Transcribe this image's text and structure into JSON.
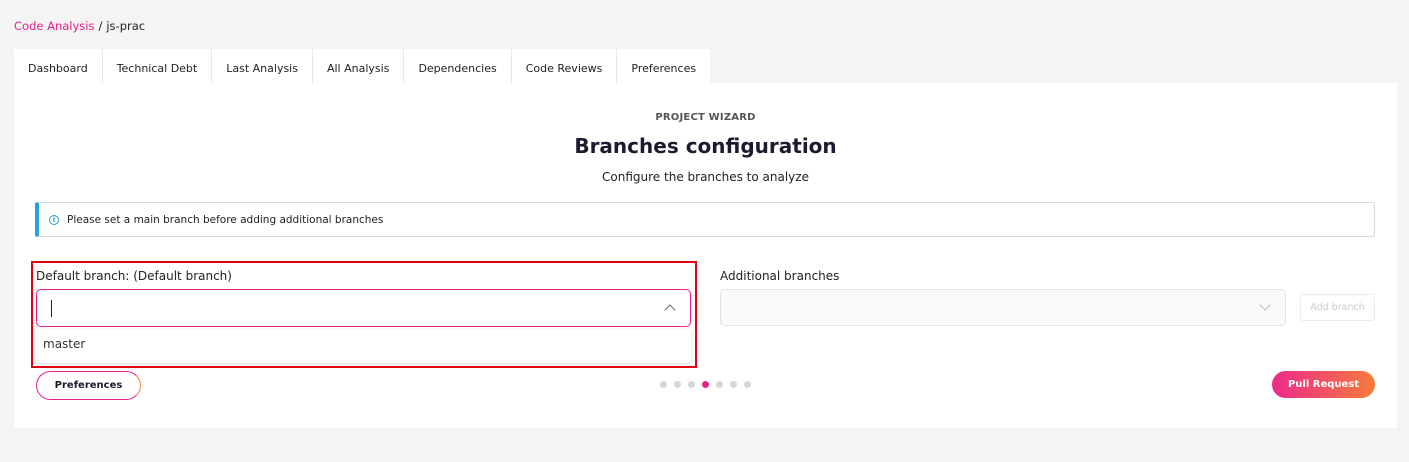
{
  "breadcrumb": {
    "parent": "Code Analysis",
    "separator": "/",
    "current": "js-prac"
  },
  "tabs": [
    "Dashboard",
    "Technical Debt",
    "Last Analysis",
    "All Analysis",
    "Dependencies",
    "Code Reviews",
    "Preferences"
  ],
  "wizard": {
    "label": "PROJECT WIZARD",
    "title": "Branches configuration",
    "subtitle": "Configure the branches to analyze"
  },
  "info": {
    "icon": "info-icon",
    "text": "Please set a main branch before adding additional branches"
  },
  "default_branch": {
    "label": "Default branch: (Default branch)",
    "value": "",
    "options": [
      "master"
    ]
  },
  "additional_branches": {
    "label": "Additional branches",
    "add_button": "Add branch"
  },
  "footer": {
    "back_button": "Preferences",
    "next_button": "Pull Request",
    "steps_total": 7,
    "current_step": 4
  },
  "colors": {
    "accent": "#e5218f",
    "accent_end": "#f77b3a",
    "info": "#2a9fe0",
    "highlight": "#e00010"
  }
}
